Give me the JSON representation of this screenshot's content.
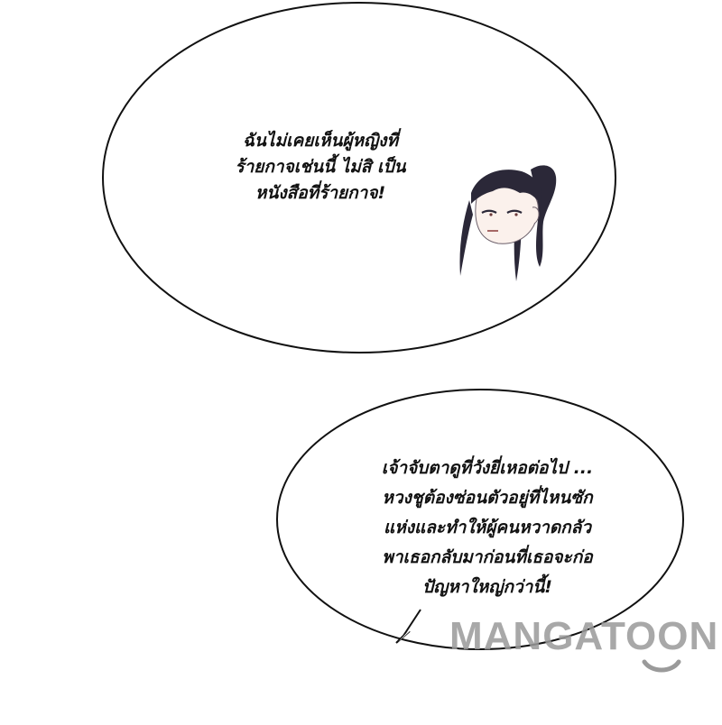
{
  "bubbles": [
    {
      "lines": [
        "ฉันไม่เคยเห็นผู้หญิงที่",
        "ร้ายกาจเช่นนี้ ไม่สิ เป็น",
        "หนังสือที่ร้ายกาจ!"
      ]
    },
    {
      "lines": [
        "เจ้าจับตาดูที่วังยี่เหอต่อไป ...",
        "หวงชูต้องซ่อนตัวอยู่ที่ไหนซัก",
        "แห่งและทำให้ผู้คนหวาดกลัว",
        "พาเธอกลับมาก่อนที่เธอจะก่อ",
        "ปัญหาใหญ่กว่านี้!"
      ]
    }
  ],
  "watermark": {
    "text": "MANGATOON"
  },
  "colors": {
    "background": "#ffffff",
    "outline": "#111111",
    "hair": "#2b2838",
    "skin": "#fbf1ec",
    "watermark": "#9a9a9a"
  }
}
